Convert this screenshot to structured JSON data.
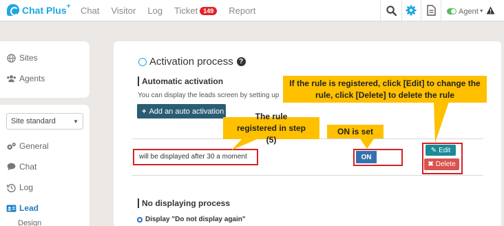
{
  "app": {
    "brand": "Chat Plus",
    "brand_sup": "+"
  },
  "nav": {
    "items": [
      "Chat",
      "Visitor",
      "Log"
    ],
    "ticket_label": "Ticket",
    "ticket_count": "149",
    "report_label": "Report"
  },
  "header": {
    "agent_label": "Agent",
    "icons": [
      "search-icon",
      "gear-icon",
      "document-icon",
      "warning-icon"
    ]
  },
  "sidebar": {
    "top_items": [
      {
        "icon": "globe-icon",
        "label": "Sites"
      },
      {
        "icon": "users-icon",
        "label": "Agents"
      }
    ],
    "site_select_value": "Site standard",
    "menu_items": [
      {
        "icon": "gears-icon",
        "label": "General"
      },
      {
        "icon": "chat-icon",
        "label": "Chat"
      },
      {
        "icon": "history-icon",
        "label": "Log"
      },
      {
        "icon": "id-card-icon",
        "label": "Lead"
      }
    ],
    "sub_item": "Design"
  },
  "main": {
    "title": "Activation process",
    "auto_heading": "Automatic activation",
    "auto_desc": "You can display the leads screen by setting up",
    "add_button": "Add an auto activation",
    "rule_text": "will be displayed after 30 a moment",
    "on_button": "ON",
    "edit_button": "Edit",
    "delete_button": "Delete",
    "no_display_heading": "No displaying process",
    "radio_label": "Display \"Do not display again\""
  },
  "callouts": {
    "edit_delete": "If the rule is registered, click [Edit] to change the rule, click [Delete] to delete the rule",
    "rule_registered": "The rule registered in step (5)",
    "on_set": "ON is set"
  },
  "colors": {
    "accent": "#1ea7e1",
    "callout": "#ffc000",
    "highlight_border": "#d42027",
    "badge": "#e0242a"
  }
}
